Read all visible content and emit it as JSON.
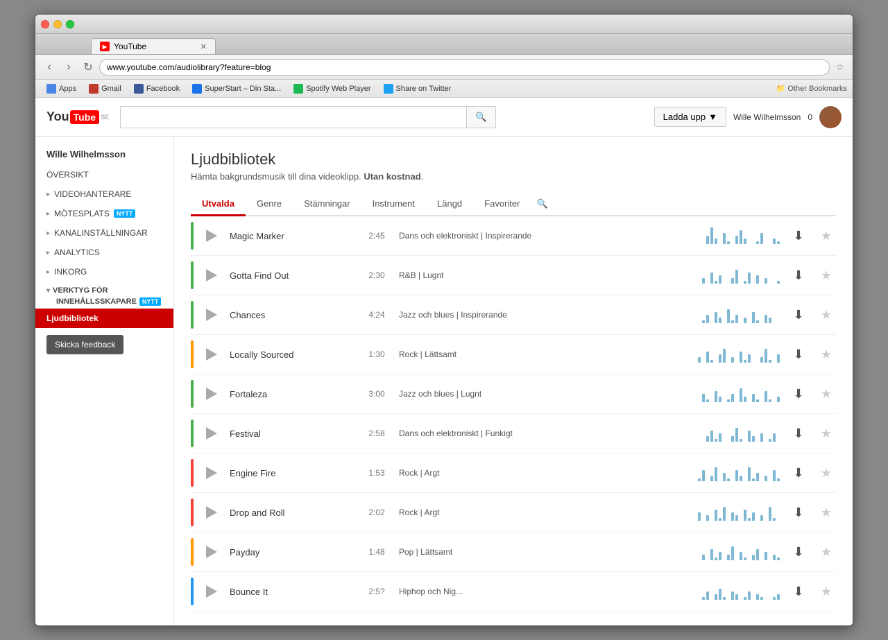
{
  "browser": {
    "url": "www.youtube.com/audiolibrary?feature=blog",
    "tab_title": "YouTube",
    "tab_favicon": "▶"
  },
  "bookmarks": {
    "items": [
      {
        "label": "Apps",
        "color": "bm-apps"
      },
      {
        "label": "Gmail",
        "color": "bm-gmail"
      },
      {
        "label": "Facebook",
        "color": "bm-fb"
      },
      {
        "label": "SuperStart – Din Sta...",
        "color": "bm-ss"
      },
      {
        "label": "Spotify Web Player",
        "color": "bm-spotify"
      },
      {
        "label": "Share on Twitter",
        "color": "bm-twitter"
      }
    ],
    "other": "Other Bookmarks"
  },
  "header": {
    "logo_text": "You",
    "logo_box": "Tube",
    "logo_se": "SE",
    "upload_label": "Ladda upp",
    "upload_arrow": "▼",
    "username": "Wille Wilhelmsson",
    "count": "0",
    "search_placeholder": ""
  },
  "sidebar": {
    "username": "Wille Wilhelmsson",
    "items": [
      {
        "label": "ÖVERSIKT",
        "arrow": false,
        "badge": null
      },
      {
        "label": "VIDEOHANTERARE",
        "arrow": true,
        "badge": null
      },
      {
        "label": "MÖTESPLATS",
        "arrow": true,
        "badge": "NYTT"
      },
      {
        "label": "KANALINSTÄLLNINGAR",
        "arrow": true,
        "badge": null
      },
      {
        "label": "ANALYTICS",
        "arrow": true,
        "badge": null
      },
      {
        "label": "INKORG",
        "arrow": true,
        "badge": null
      }
    ],
    "section_label": "VERKTYG FÖR",
    "section_sub": "INNEHÅLLSSKAPARE",
    "section_badge": "NYTT",
    "active_item": "Ljudbibliotek",
    "feedback_btn": "Skicka feedback"
  },
  "content": {
    "title": "Ljudbibliotek",
    "subtitle_normal": "Hämta bakgrundsmusik till dina videoklipp.",
    "subtitle_bold": "Utan kostnad",
    "subtitle_end": ".",
    "tabs": [
      {
        "label": "Utvalda",
        "active": true
      },
      {
        "label": "Genre",
        "active": false
      },
      {
        "label": "Stämningar",
        "active": false
      },
      {
        "label": "Instrument",
        "active": false
      },
      {
        "label": "Längd",
        "active": false
      },
      {
        "label": "Favoriter",
        "active": false
      }
    ],
    "tracks": [
      {
        "name": "Magic Marker",
        "duration": "2:45",
        "genre": "Dans och elektroniskt | Inspirerande",
        "color": "#4caf50",
        "waveform_width": 85
      },
      {
        "name": "Gotta Find Out",
        "duration": "2:30",
        "genre": "R&B | Lugnt",
        "color": "#4caf50",
        "waveform_width": 55
      },
      {
        "name": "Chances",
        "duration": "4:24",
        "genre": "Jazz och blues | Inspirerande",
        "color": "#4caf50",
        "waveform_width": 60
      },
      {
        "name": "Locally Sourced",
        "duration": "1:30",
        "genre": "Rock | Lättsamt",
        "color": "#ff9800",
        "waveform_width": 60
      },
      {
        "name": "Fortaleza",
        "duration": "3:00",
        "genre": "Jazz och blues | Lugnt",
        "color": "#4caf50",
        "waveform_width": 50
      },
      {
        "name": "Festival",
        "duration": "2:58",
        "genre": "Dans och elektroniskt | Funkigt",
        "color": "#4caf50",
        "waveform_width": 45
      },
      {
        "name": "Engine Fire",
        "duration": "1:53",
        "genre": "Rock | Argt",
        "color": "#f44336",
        "waveform_width": 60
      },
      {
        "name": "Drop and Roll",
        "duration": "2:02",
        "genre": "Rock | Argt",
        "color": "#f44336",
        "waveform_width": 60
      },
      {
        "name": "Payday",
        "duration": "1:48",
        "genre": "Pop | Lättsamt",
        "color": "#ff9800",
        "waveform_width": 50
      },
      {
        "name": "Bounce It",
        "duration": "2:5?",
        "genre": "Hiphop och Nig...",
        "color": "#2196f3",
        "waveform_width": 30
      }
    ]
  }
}
